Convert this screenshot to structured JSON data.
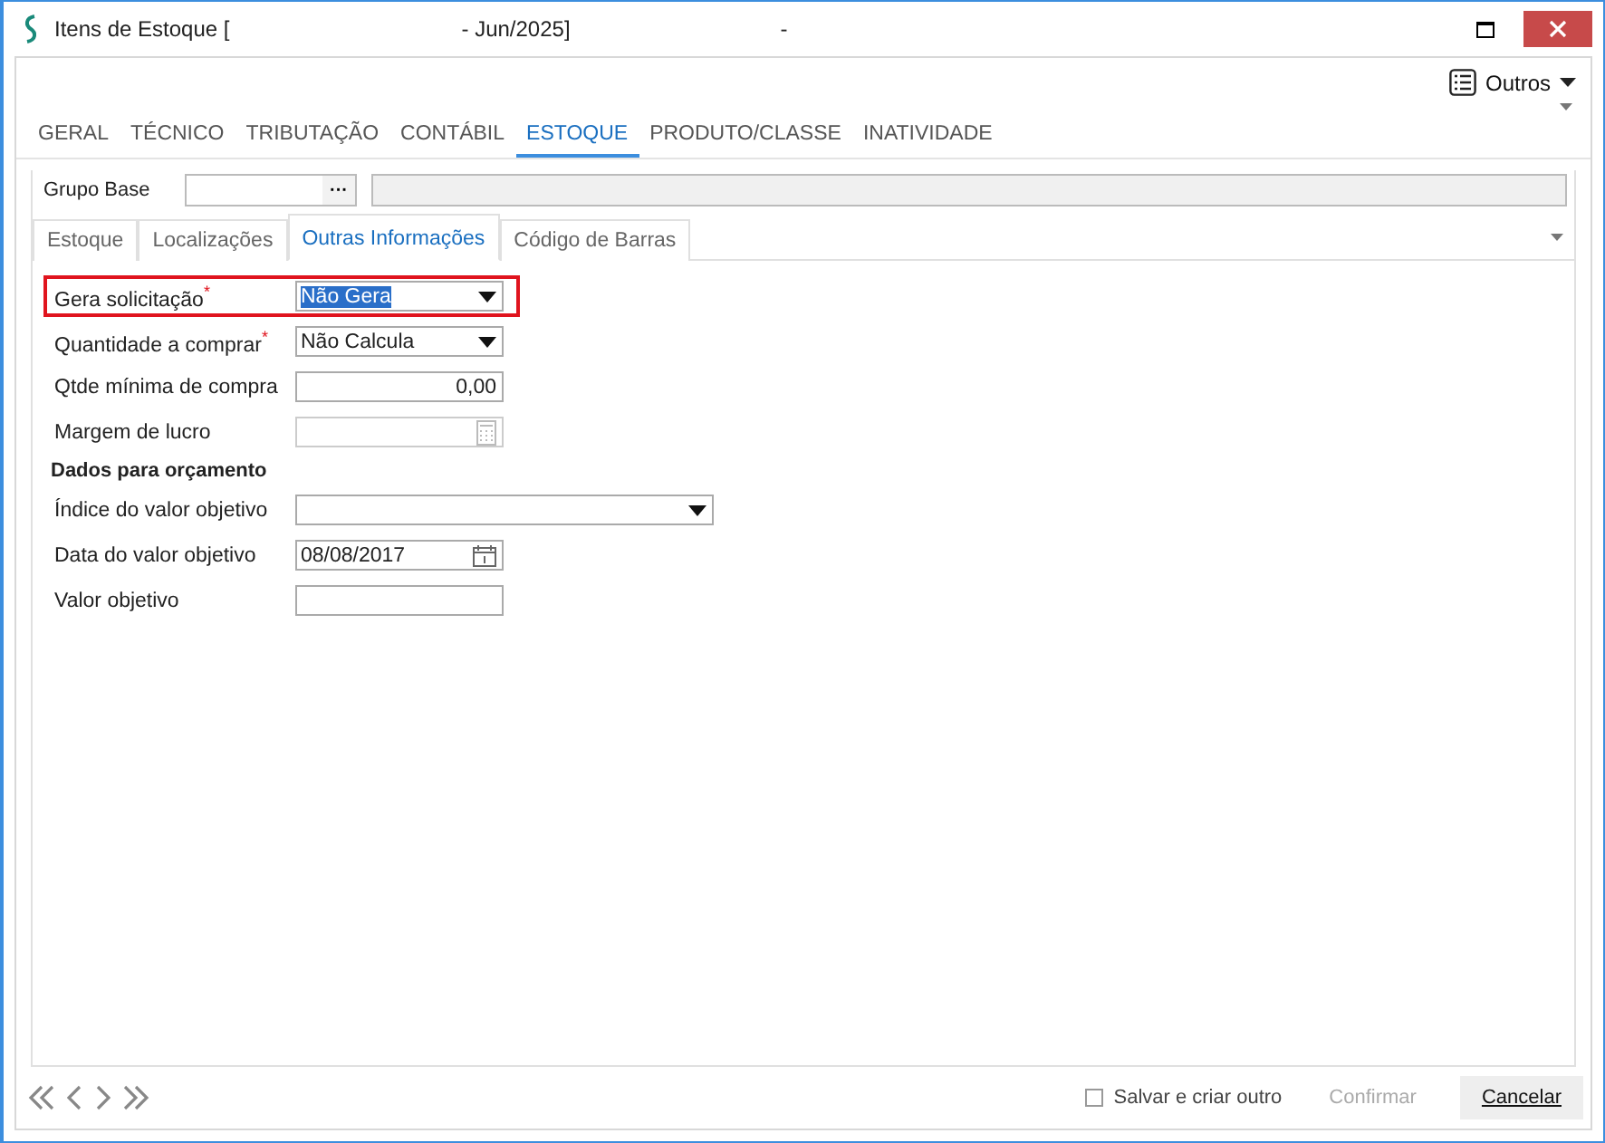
{
  "window": {
    "title_parts": [
      "Itens de Estoque [",
      "- Jun/2025]",
      "-"
    ]
  },
  "toolbar": {
    "menu_label": "Outros"
  },
  "tabs": [
    {
      "label": "GERAL",
      "selected": false
    },
    {
      "label": "TÉCNICO",
      "selected": false
    },
    {
      "label": "TRIBUTAÇÃO",
      "selected": false
    },
    {
      "label": "CONTÁBIL",
      "selected": false
    },
    {
      "label": "ESTOQUE",
      "selected": true
    },
    {
      "label": "PRODUTO/CLASSE",
      "selected": false
    },
    {
      "label": "INATIVIDADE",
      "selected": false
    }
  ],
  "grupo_base": {
    "label": "Grupo Base",
    "button": "···"
  },
  "subtabs": [
    {
      "label": "Estoque",
      "selected": false
    },
    {
      "label": "Localizações",
      "selected": false
    },
    {
      "label": "Outras Informações",
      "selected": true
    },
    {
      "label": "Código de Barras",
      "selected": false
    }
  ],
  "fields": [
    {
      "kind": "select",
      "label": "Gera solicitação",
      "mark": "*",
      "value": "Não Gera",
      "highlighted": true
    },
    {
      "kind": "select",
      "label": "Quantidade a comprar",
      "mark": "*",
      "value": "Não Calcula",
      "highlighted": false
    },
    {
      "kind": "number",
      "label": "Qtde mínima de compra",
      "value": "0,00",
      "highlighted": false
    },
    {
      "kind": "calc",
      "label": "Margem de lucro",
      "highlighted": false
    },
    {
      "kind": "heading",
      "label": "Dados para orçamento"
    },
    {
      "kind": "combo",
      "label": "Índice do valor objetivo",
      "highlighted": false
    },
    {
      "kind": "date",
      "label": "Data do valor objetivo",
      "value": "08/08/2017",
      "highlighted": false
    },
    {
      "kind": "text",
      "label": "Valor objetivo",
      "highlighted": false
    }
  ],
  "footer": {
    "save_and_new": {
      "label": "Salvar e criar outro",
      "checked": false
    },
    "confirm": {
      "label": "Confirmar",
      "disabled": true
    },
    "cancel": {
      "label": "Cancelar",
      "disabled": false
    }
  }
}
